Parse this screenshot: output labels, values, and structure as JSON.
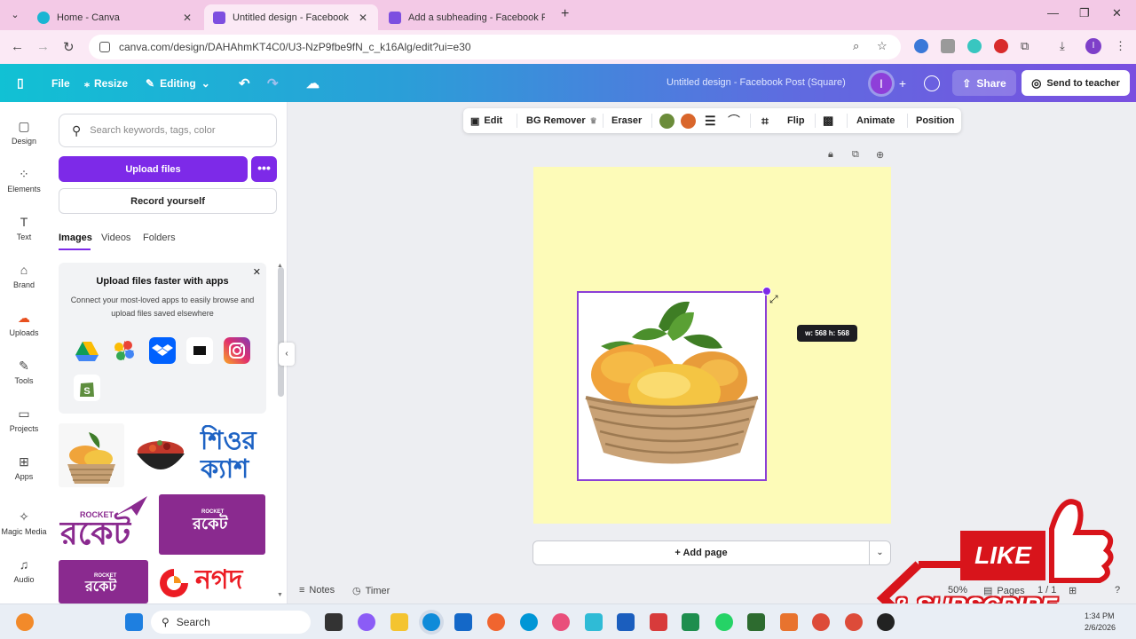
{
  "browser": {
    "tabs": [
      {
        "label": "Home - Canva",
        "active": false
      },
      {
        "label": "Untitled design - Facebook Post",
        "active": true
      },
      {
        "label": "Add a subheading - Facebook P",
        "active": false
      }
    ],
    "url": "canva.com/design/DAHAhmKT4C0/U3-NzP9fbe9fN_c_k16Alg/edit?ui=e30",
    "profile_initial": "I"
  },
  "header": {
    "file": "File",
    "resize": "Resize",
    "editing": "Editing",
    "title": "Untitled design - Facebook Post (Square)",
    "avatar_initial": "I",
    "share": "Share",
    "send_to_teacher": "Send to teacher"
  },
  "rail": {
    "items": [
      "Design",
      "Elements",
      "Text",
      "Brand",
      "Uploads",
      "Tools",
      "Projects",
      "Apps",
      "Magic Media",
      "Audio"
    ]
  },
  "panel": {
    "search_placeholder": "Search keywords, tags, color",
    "upload_files": "Upload files",
    "more": "•••",
    "record_yourself": "Record yourself",
    "tabs": [
      "Images",
      "Videos",
      "Folders"
    ],
    "promo": {
      "title": "Upload files faster with apps",
      "body": "Connect your most-loved apps to easily browse and upload files saved elsewhere"
    },
    "thumbs": {
      "bengali_1": "শিওর",
      "bengali_2": "ক্যাশ",
      "rocket_small": "ROCKET",
      "rocket_big": "রকেট",
      "nagad": "নগদ"
    }
  },
  "toolbar": {
    "edit": "Edit",
    "bg_remover": "BG Remover",
    "eraser": "Eraser",
    "flip": "Flip",
    "animate": "Animate",
    "position": "Position",
    "swatch_colors": [
      "#6b8c3a",
      "#d9662b"
    ]
  },
  "canvas": {
    "size_tooltip": "w: 568 h: 568",
    "add_page": "+ Add page"
  },
  "footer": {
    "notes": "Notes",
    "timer": "Timer",
    "zoom": "50%",
    "pages": "Pages",
    "page_count": "1 / 1"
  },
  "overlay": {
    "like": "LIKE",
    "subscribe": "& SUBSCRIBE"
  },
  "taskbar": {
    "search": "Search",
    "time": "1:34 PM",
    "date": "2/6/2026"
  }
}
